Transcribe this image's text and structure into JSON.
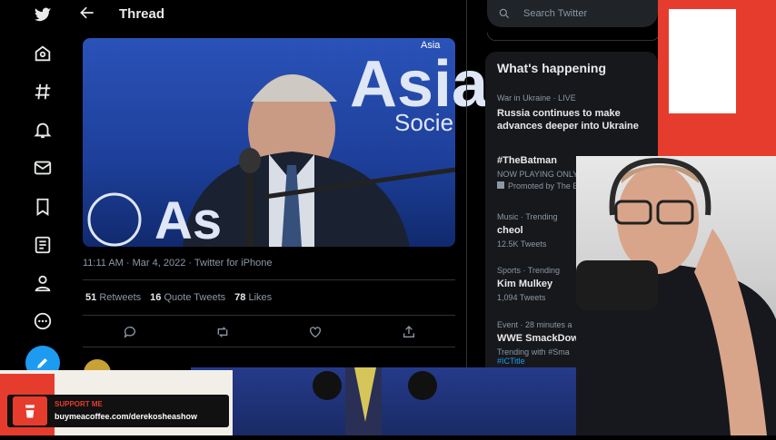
{
  "header": {
    "back_icon": "arrow-left-icon",
    "title": "Thread"
  },
  "nav": {
    "items": [
      {
        "icon": "twitter-logo-icon"
      },
      {
        "icon": "home-icon"
      },
      {
        "icon": "hashtag-icon"
      },
      {
        "icon": "bell-icon"
      },
      {
        "icon": "mail-icon"
      },
      {
        "icon": "bookmark-icon"
      },
      {
        "icon": "list-icon"
      },
      {
        "icon": "profile-icon"
      },
      {
        "icon": "more-icon"
      },
      {
        "icon": "compose-icon"
      }
    ],
    "accent": "#1d9bf0"
  },
  "tweet": {
    "media_watermark": "Asia",
    "media_text_large": "Asia",
    "media_text_sub": "Socie",
    "media_text_bottom": "As",
    "timestamp": "11:11 AM · Mar 4, 2022 · Twitter for iPhone",
    "stats": [
      {
        "count": "51",
        "label": "Retweets"
      },
      {
        "count": "16",
        "label": "Quote Tweets"
      },
      {
        "count": "78",
        "label": "Likes"
      }
    ],
    "actions": [
      "reply-icon",
      "retweet-icon",
      "like-icon",
      "share-icon"
    ]
  },
  "search": {
    "placeholder": "Search Twitter"
  },
  "whats_happening": {
    "title": "What's happening",
    "trends": [
      {
        "context": "War in Ukraine · LIVE",
        "title": "Russia continues to make advances deeper into Ukraine",
        "sub": ""
      },
      {
        "context": "",
        "title": "#TheBatman",
        "sub": "NOW PLAYING ONLY IN THEAT",
        "promo": "Promoted by The Batman"
      },
      {
        "context": "Music · Trending",
        "title": "cheol",
        "sub": "12.5K Tweets"
      },
      {
        "context": "Sports · Trending",
        "title": "Kim Mulkey",
        "sub": "1,094 Tweets"
      },
      {
        "context": "Event · 28 minutes a",
        "title": "WWE SmackDow",
        "sub": "Trending with #Sma",
        "extra": "#ICTitle"
      }
    ]
  },
  "support": {
    "label": "SUPPORT ME",
    "url": "buymeacoffee.com/derekosheashow"
  },
  "colors": {
    "brand_red": "#e53c2e",
    "twitter_blue": "#1d9bf0"
  }
}
